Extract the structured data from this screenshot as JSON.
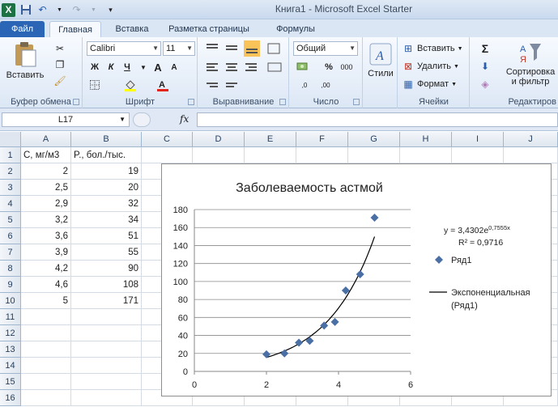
{
  "titlebar": {
    "title": "Книга1 - Microsoft Excel Starter",
    "app_icon": "X"
  },
  "tabs": [
    {
      "label": "Файл",
      "kind": "file"
    },
    {
      "label": "Главная",
      "kind": "active"
    },
    {
      "label": "Вставка",
      "kind": "normal"
    },
    {
      "label": "Разметка страницы",
      "kind": "normal"
    },
    {
      "label": "Формулы",
      "kind": "normal"
    }
  ],
  "ribbon": {
    "clipboard": {
      "paste": "Вставить",
      "label": "Буфер обмена"
    },
    "font": {
      "name": "Calibri",
      "size": "11",
      "bold": "Ж",
      "italic": "К",
      "underline": "Ч",
      "grow": "A",
      "shrink": "A",
      "label": "Шрифт"
    },
    "alignment": {
      "label": "Выравнивание"
    },
    "number": {
      "format": "Общий",
      "percent": "%",
      "thousands": "000",
      "inc_decimal": ",0",
      "dec_decimal": ",00",
      "label": "Число"
    },
    "styles": {
      "button": "Стили"
    },
    "cells": {
      "insert": "Вставить",
      "delete": "Удалить",
      "format": "Формат",
      "label": "Ячейки"
    },
    "editing": {
      "sort": "Сортировка",
      "filter": "и фильтр",
      "label": "Редактиров"
    }
  },
  "formula_bar": {
    "name_box": "L17",
    "fx": "fx",
    "value": ""
  },
  "columns": [
    "A",
    "B",
    "C",
    "D",
    "E",
    "F",
    "G",
    "H",
    "I",
    "J"
  ],
  "rows": [
    "1",
    "2",
    "3",
    "4",
    "5",
    "6",
    "7",
    "8",
    "9",
    "10",
    "11",
    "12",
    "13",
    "14",
    "15",
    "16"
  ],
  "headers": {
    "a1": "C, мг/м3",
    "b1": "P., бол./тыс."
  },
  "table": [
    {
      "c": "2",
      "p": "19"
    },
    {
      "c": "2,5",
      "p": "20"
    },
    {
      "c": "2,9",
      "p": "32"
    },
    {
      "c": "3,2",
      "p": "34"
    },
    {
      "c": "3,6",
      "p": "51"
    },
    {
      "c": "3,9",
      "p": "55"
    },
    {
      "c": "4,2",
      "p": "90"
    },
    {
      "c": "4,6",
      "p": "108"
    },
    {
      "c": "5",
      "p": "171"
    }
  ],
  "chart_data": {
    "type": "scatter",
    "title": "Заболеваемость астмой",
    "x": [
      2,
      2.5,
      2.9,
      3.2,
      3.6,
      3.9,
      4.2,
      4.6,
      5
    ],
    "y": [
      19,
      20,
      32,
      34,
      51,
      55,
      90,
      108,
      171
    ],
    "xlim": [
      0,
      6
    ],
    "ylim": [
      0,
      180
    ],
    "xticks": [
      0,
      2,
      4,
      6
    ],
    "yticks": [
      0,
      20,
      40,
      60,
      80,
      100,
      120,
      140,
      160,
      180
    ],
    "trendline": {
      "type": "exponential",
      "a": 3.4302,
      "b": 0.7555,
      "x_range": [
        2,
        5
      ]
    },
    "equation": "y = 3,4302e",
    "equation_exp": "0,7555x",
    "r_squared": "R² = 0,9716",
    "legend": [
      {
        "label": "Ряд1",
        "marker": "diamond"
      },
      {
        "label": "Экспоненциальная",
        "label2": "(Ряд1)",
        "marker": "line"
      }
    ],
    "marker_color": "#4a6fa5",
    "line_color": "#000000",
    "grid": "horizontal",
    "legend_position": "right"
  }
}
